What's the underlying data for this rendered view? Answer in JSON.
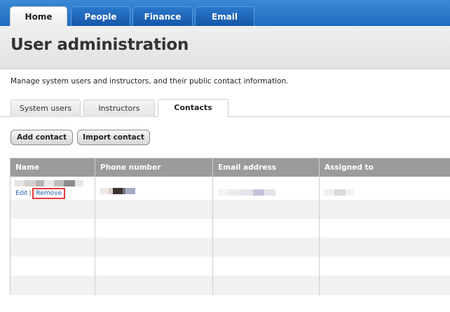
{
  "nav": {
    "tabs": [
      {
        "label": "Home",
        "active": true
      },
      {
        "label": "People",
        "active": false
      },
      {
        "label": "Finance",
        "active": false
      },
      {
        "label": "Email",
        "active": false
      }
    ]
  },
  "header": {
    "title": "User administration"
  },
  "description": "Manage system users and instructors, and their public contact information.",
  "subtabs": [
    {
      "label": "System users",
      "active": false
    },
    {
      "label": "Instructors",
      "active": false
    },
    {
      "label": "Contacts",
      "active": true
    }
  ],
  "actions": {
    "add_label": "Add contact",
    "import_label": "Import contact"
  },
  "table": {
    "columns": [
      "Name",
      "Phone number",
      "Email address",
      "Assigned to"
    ],
    "rows": [
      {
        "edit_label": "Edit",
        "separator": "|",
        "remove_label": "Remove"
      }
    ]
  },
  "colors": {
    "nav_blue": "#1f6bbf",
    "header_gray": "#9b9b9b",
    "highlight_red": "#e23b3b",
    "link_blue": "#1a5aa8"
  }
}
